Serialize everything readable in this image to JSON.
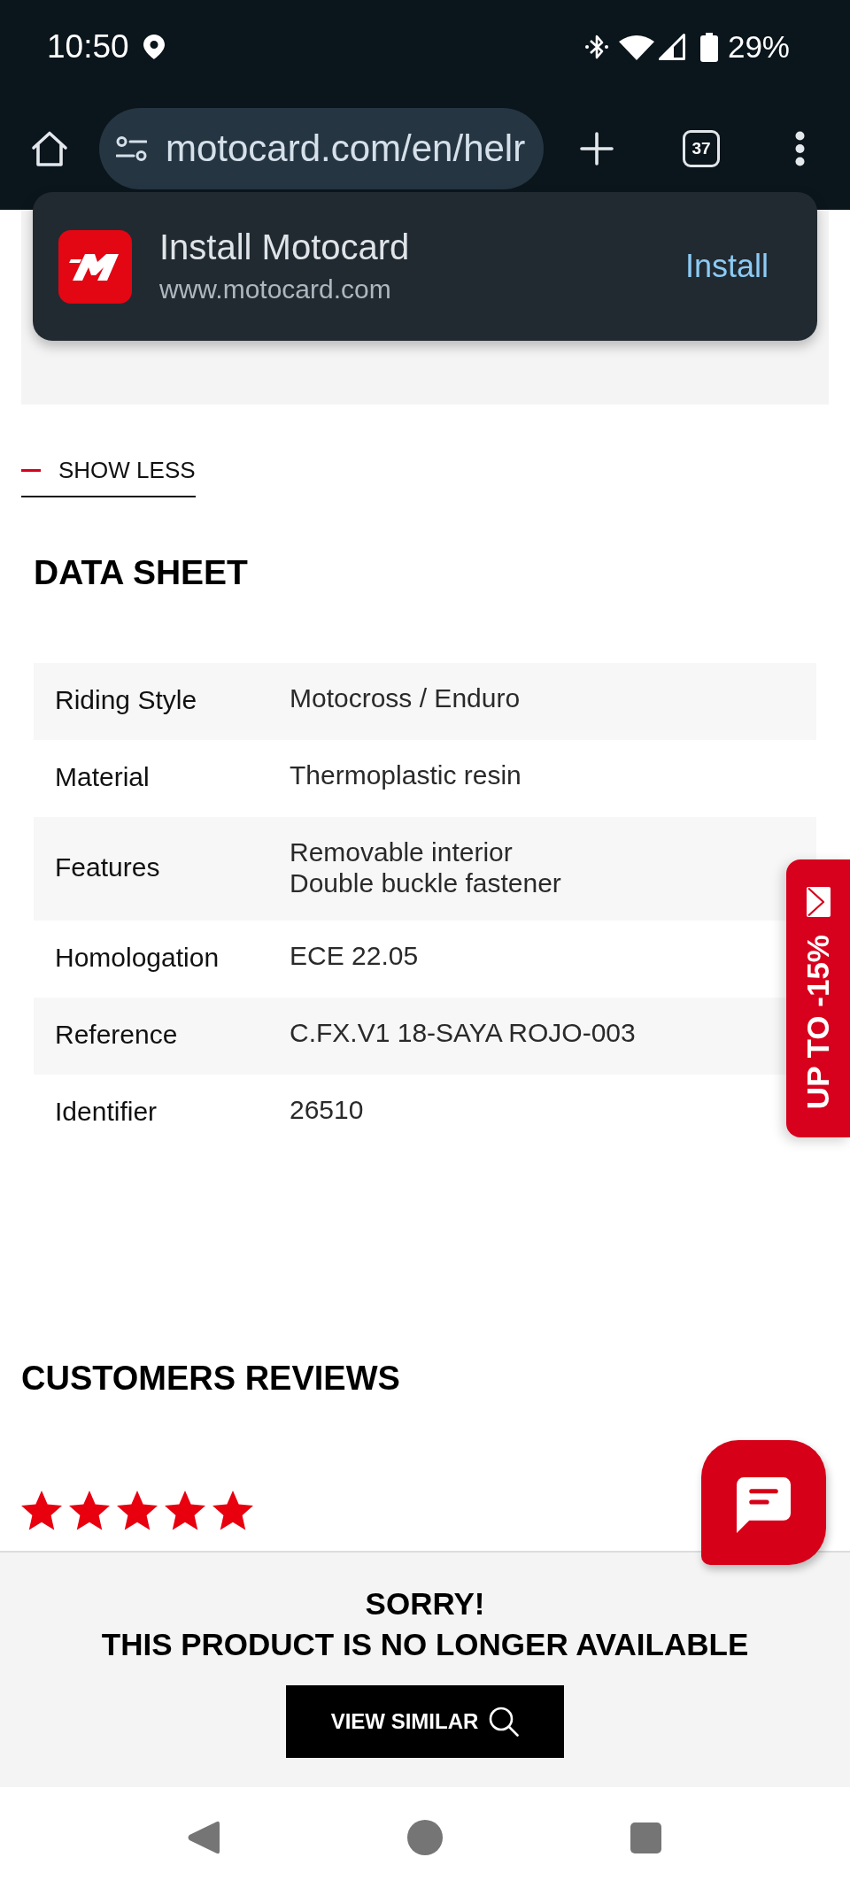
{
  "status_bar": {
    "time": "10:50",
    "battery": "29%"
  },
  "browser_toolbar": {
    "url": "motocard.com/en/helr",
    "tab_count": "37"
  },
  "install_prompt": {
    "title": "Install Motocard",
    "subtitle": "www.motocard.com",
    "button": "Install"
  },
  "description_toggle": {
    "label": "SHOW LESS",
    "expanded": true
  },
  "data_sheet": {
    "title": "DATA SHEET",
    "rows": [
      {
        "label": "Riding Style",
        "values": [
          "Motocross / Enduro"
        ]
      },
      {
        "label": "Material",
        "values": [
          "Thermoplastic resin"
        ]
      },
      {
        "label": "Features",
        "values": [
          "Removable interior",
          "Double buckle fastener"
        ]
      },
      {
        "label": "Homologation",
        "values": [
          "ECE 22.05"
        ]
      },
      {
        "label": "Reference",
        "values": [
          "C.FX.V1 18-SAYA ROJO-003"
        ]
      },
      {
        "label": "Identifier",
        "values": [
          "26510"
        ]
      }
    ]
  },
  "promo_tab": {
    "label": "UP TO -15%"
  },
  "reviews": {
    "title": "CUSTOMERS REVIEWS",
    "stars": 5
  },
  "unavailable_notice": {
    "title": "SORRY!",
    "message": "THIS PRODUCT IS NO LONGER AVAILABLE",
    "button": "VIEW SIMILAR"
  }
}
